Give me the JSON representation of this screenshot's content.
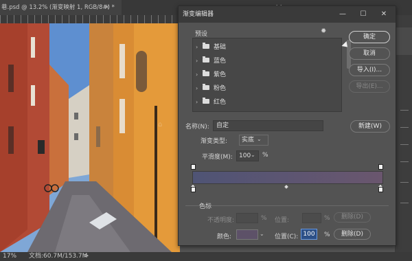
{
  "document": {
    "tab_title": "巷.psd @ 13.2% (渐变映射 1, RGB/8#) *",
    "close_icon": "×"
  },
  "statusbar": {
    "zoom": "17%",
    "doc_size": "文档:60.7M/153.7M",
    "arrow": ">"
  },
  "panel_arrows": "◂◂",
  "dialog": {
    "title": "渐变编辑器",
    "window_buttons": {
      "minimize": "—",
      "maximize": "☐",
      "close": "✕"
    },
    "presets": {
      "label": "预设",
      "gear_icon": "✹",
      "folders": [
        {
          "label": "基础"
        },
        {
          "label": "蓝色"
        },
        {
          "label": "紫色"
        },
        {
          "label": "粉色"
        },
        {
          "label": "红色"
        }
      ]
    },
    "buttons": {
      "ok": "确定",
      "cancel": "取消",
      "import": "导入(I)...",
      "export": "导出(E)...",
      "new": "新建(W)"
    },
    "name": {
      "label": "名称(N):",
      "value": "自定"
    },
    "gradient_type": {
      "label": "渐变类型:",
      "value": "实底"
    },
    "smoothness": {
      "label": "平滑度(M):",
      "value": "100",
      "unit": "%"
    },
    "gradient": {
      "start_color": "#4f5475",
      "end_color": "#6a566e"
    },
    "color_stops": {
      "label": "色标",
      "opacity": {
        "label": "不透明度:",
        "unit": "%"
      },
      "location_top": {
        "label": "位置:",
        "unit": "%"
      },
      "delete_top": "删除(D)",
      "color": {
        "label": "颜色:",
        "swatch": "#5d5168"
      },
      "location": {
        "label": "位置(C):",
        "value": "100",
        "unit": "%"
      },
      "delete": "删除(D)"
    }
  }
}
